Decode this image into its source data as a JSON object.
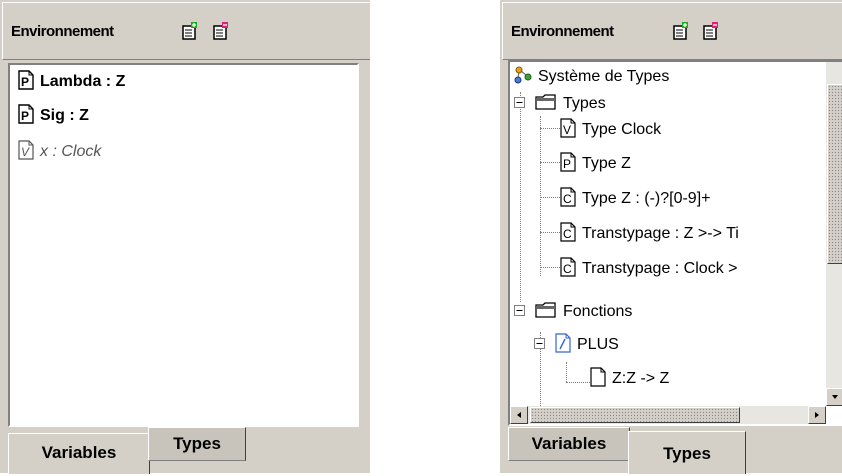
{
  "left_panel": {
    "header_title": "Environnement",
    "variables": [
      {
        "icon": "P",
        "text": "Lambda : Z",
        "style": "bold"
      },
      {
        "icon": "P",
        "text": "Sig : Z",
        "style": "bold"
      },
      {
        "icon": "V",
        "text": "x : Clock",
        "style": "italic"
      }
    ],
    "tabs": [
      {
        "label": "Variables",
        "selected": true
      },
      {
        "label": "Types",
        "selected": false
      }
    ]
  },
  "right_panel": {
    "header_title": "Environnement",
    "tree": {
      "root": "Système de Types",
      "types_folder": "Types",
      "types_items": [
        {
          "icon": "V",
          "label": "Type Clock"
        },
        {
          "icon": "P",
          "label": "Type Z"
        },
        {
          "icon": "C",
          "label": "Type Z : (-)?[0-9]+"
        },
        {
          "icon": "C",
          "label": "Transtypage : Z >-> Ti"
        },
        {
          "icon": "C",
          "label": "Transtypage : Clock >"
        }
      ],
      "functions_folder": "Fonctions",
      "function_name": "PLUS",
      "function_signature": "Z:Z -> Z"
    },
    "tabs": [
      {
        "label": "Variables",
        "selected": false
      },
      {
        "label": "Types",
        "selected": true
      }
    ]
  },
  "colors": {
    "panel_bg": "#d4d0c8",
    "content_bg": "#ffffff",
    "function_icon": "#3366cc"
  }
}
